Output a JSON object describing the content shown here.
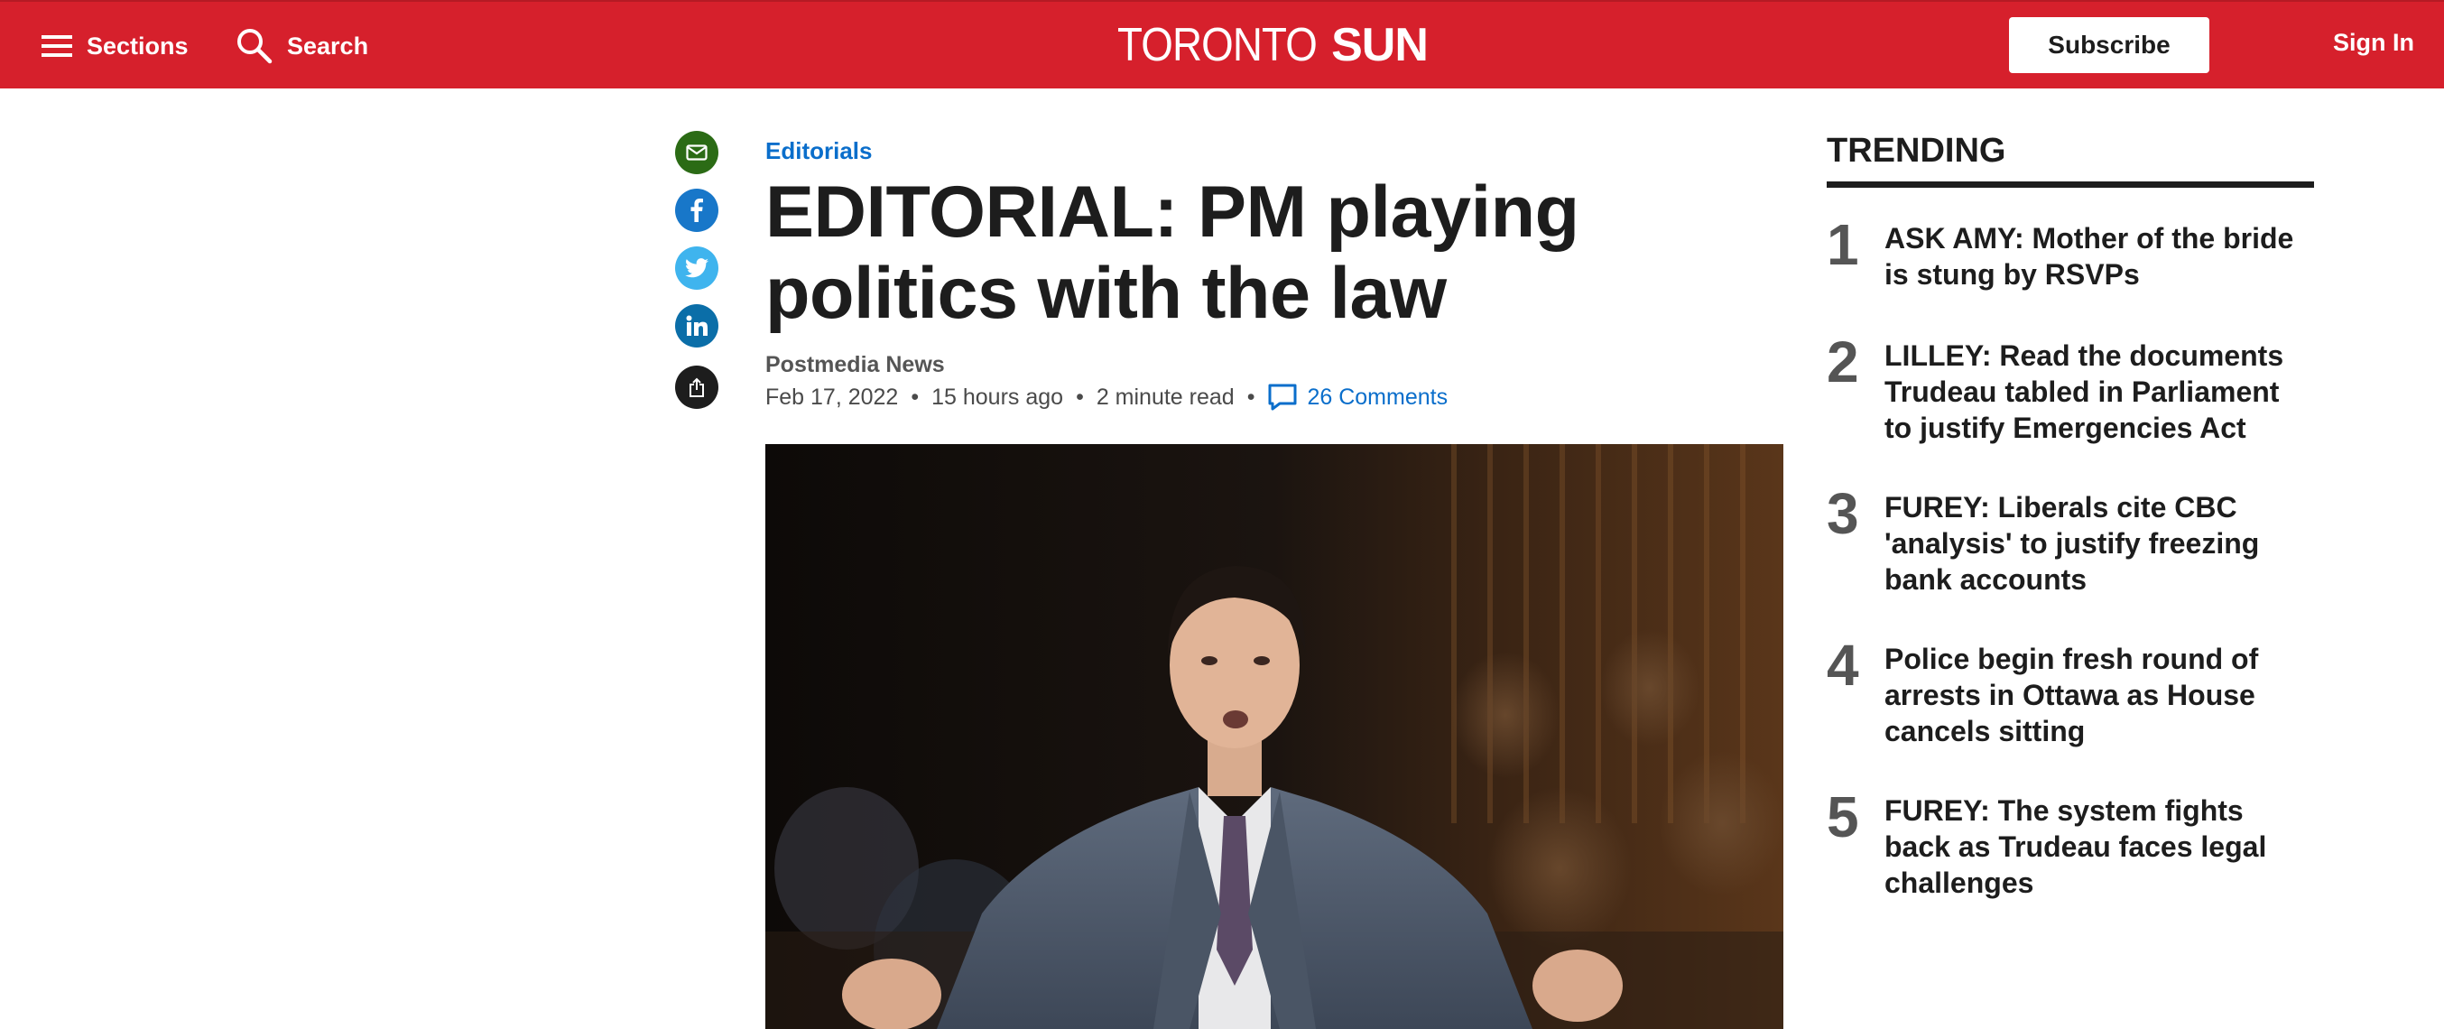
{
  "header": {
    "sections_label": "Sections",
    "search_label": "Search",
    "logo_word1": "TORONTO",
    "logo_word2": "SUN",
    "subscribe_label": "Subscribe",
    "signin_label": "Sign In",
    "brand_color": "#d6202c"
  },
  "share": {
    "icons": [
      "email-icon",
      "facebook-icon",
      "twitter-icon",
      "linkedin-icon",
      "share-icon"
    ]
  },
  "article": {
    "category": "Editorials",
    "headline": "EDITORIAL: PM playing politics with the law",
    "author": "Postmedia News",
    "date": "Feb 17, 2022",
    "time_ago": "15 hours ago",
    "read_time": "2 minute read",
    "comments": "26 Comments",
    "separator": "•"
  },
  "trending": {
    "title": "TRENDING",
    "items": [
      {
        "num": "1",
        "text": "ASK AMY: Mother of the bride is stung by RSVPs"
      },
      {
        "num": "2",
        "text": "LILLEY: Read the documents Trudeau tabled in Parliament to justify Emergencies Act"
      },
      {
        "num": "3",
        "text": "FUREY: Liberals cite CBC 'analysis' to justify freezing bank accounts"
      },
      {
        "num": "4",
        "text": "Police begin fresh round of arrests in Ottawa as House cancels sitting"
      },
      {
        "num": "5",
        "text": "FUREY: The system fights back as Trudeau faces legal challenges"
      }
    ]
  }
}
